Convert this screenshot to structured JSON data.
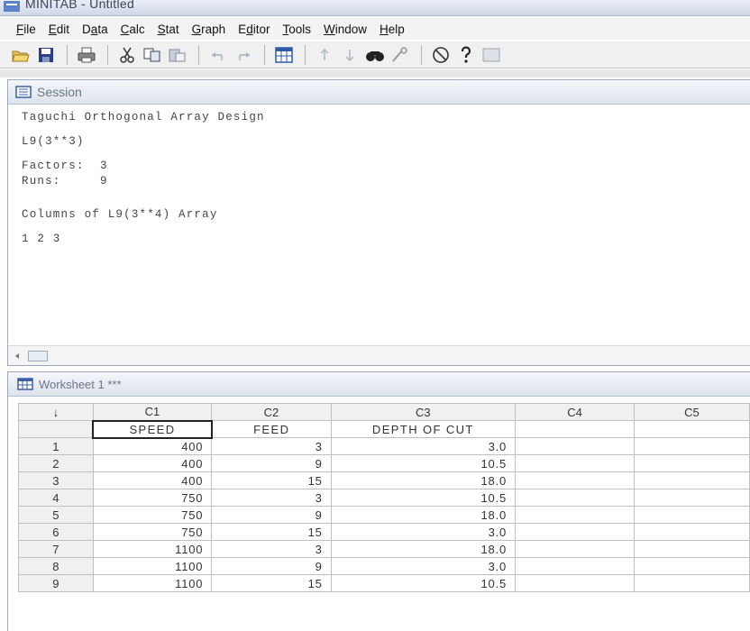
{
  "app": {
    "title": "MINITAB - Untitled"
  },
  "menu": [
    {
      "label": "File",
      "key": "F",
      "rest": "ile"
    },
    {
      "label": "Edit",
      "key": "E",
      "rest": "dit"
    },
    {
      "label": "Data",
      "pre": "D",
      "key": "a",
      "rest": "ta"
    },
    {
      "label": "Calc",
      "key": "C",
      "rest": "alc"
    },
    {
      "label": "Stat",
      "key": "S",
      "rest": "tat"
    },
    {
      "label": "Graph",
      "key": "G",
      "rest": "raph"
    },
    {
      "label": "Editor",
      "pre": "E",
      "key": "d",
      "rest": "itor"
    },
    {
      "label": "Tools",
      "key": "T",
      "rest": "ools"
    },
    {
      "label": "Window",
      "key": "W",
      "rest": "indow"
    },
    {
      "label": "Help",
      "key": "H",
      "rest": "elp"
    }
  ],
  "session": {
    "title": "Session",
    "lines": {
      "heading": "Taguchi Orthogonal Array Design",
      "design": "L9(3**3)",
      "factors": "Factors:  3",
      "runs": "Runs:     9",
      "columns": "Columns of L9(3**4) Array",
      "cols": "1 2 3"
    }
  },
  "worksheet": {
    "title": "Worksheet 1 ***",
    "corner": "↓",
    "columns": [
      {
        "id": "C1",
        "name": "SPEED"
      },
      {
        "id": "C2",
        "name": "FEED"
      },
      {
        "id": "C3",
        "name": "DEPTH OF CUT"
      },
      {
        "id": "C4",
        "name": ""
      },
      {
        "id": "C5",
        "name": ""
      }
    ],
    "rows": [
      {
        "n": "1",
        "c1": "400",
        "c2": "3",
        "c3": "3.0"
      },
      {
        "n": "2",
        "c1": "400",
        "c2": "9",
        "c3": "10.5"
      },
      {
        "n": "3",
        "c1": "400",
        "c2": "15",
        "c3": "18.0"
      },
      {
        "n": "4",
        "c1": "750",
        "c2": "3",
        "c3": "10.5"
      },
      {
        "n": "5",
        "c1": "750",
        "c2": "9",
        "c3": "18.0"
      },
      {
        "n": "6",
        "c1": "750",
        "c2": "15",
        "c3": "3.0"
      },
      {
        "n": "7",
        "c1": "1100",
        "c2": "3",
        "c3": "18.0"
      },
      {
        "n": "8",
        "c1": "1100",
        "c2": "9",
        "c3": "3.0"
      },
      {
        "n": "9",
        "c1": "1100",
        "c2": "15",
        "c3": "10.5"
      }
    ]
  },
  "toolbar": [
    "open-icon",
    "save-icon",
    "print-icon",
    "cut-icon",
    "copy-icon",
    "paste-icon",
    "undo-icon",
    "redo-icon",
    "worksheet-icon",
    "up-arrow-icon",
    "down-arrow-icon",
    "find-icon",
    "find-replace-icon",
    "cancel-icon",
    "help-icon",
    "info-icon"
  ]
}
